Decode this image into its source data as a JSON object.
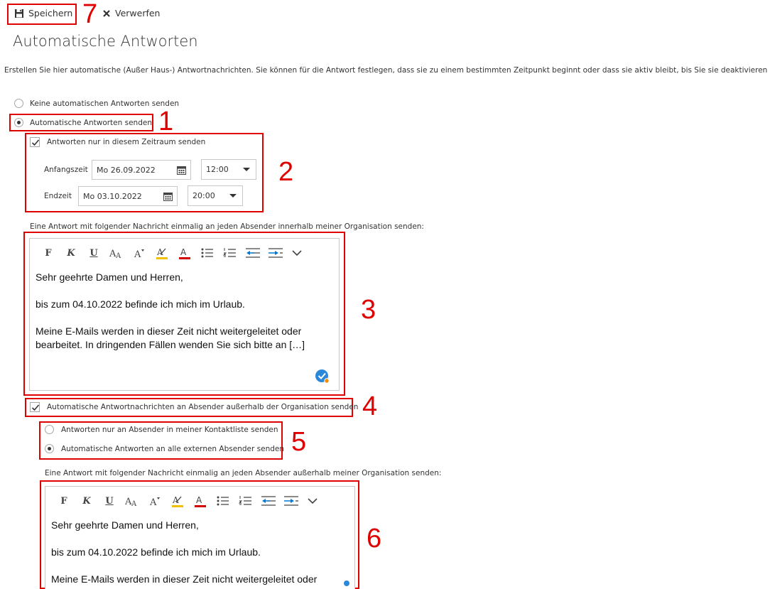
{
  "toolbar": {
    "save_label": "Speichern",
    "discard_label": "Verwerfen"
  },
  "page": {
    "title": "Automatische Antworten",
    "description": "Erstellen Sie hier automatische (Außer Haus-) Antwortnachrichten. Sie können für die Antwort festlegen, dass sie zu einem bestimmten Zeitpunkt beginnt oder dass sie aktiv bleibt, bis Sie sie deaktivieren"
  },
  "options": {
    "no_reply": "Keine automatischen Antworten senden",
    "send_reply": "Automatische Antworten senden",
    "time_range": "Antworten nur in diesem Zeitraum senden"
  },
  "schedule": {
    "start_label": "Anfangszeit",
    "start_date": "Mo 26.09.2022",
    "start_time": "12:00",
    "end_label": "Endzeit",
    "end_date": "Mo 03.10.2022",
    "end_time": "20:00"
  },
  "internal": {
    "label": "Eine Antwort mit folgender Nachricht einmalig an jeden Absender innerhalb meiner Organisation senden:",
    "lines": [
      "Sehr geehrte Damen und Herren,",
      "bis zum 04.10.2022 befinde ich mich im Urlaub.",
      "Meine E-Mails werden in dieser Zeit nicht weitergeleitet oder",
      "bearbeitet. In dringenden Fällen wenden Sie sich bitte an […]"
    ]
  },
  "external": {
    "toggle": "Automatische Antwortnachrichten an Absender außerhalb der Organisation senden",
    "contacts_only": "Antworten nur an Absender in meiner Kontaktliste senden",
    "all_external": "Automatische Antworten an alle externen Absender senden",
    "label": "Eine Antwort mit folgender Nachricht einmalig an jeden Absender außerhalb meiner Organisation senden:",
    "lines": [
      "Sehr geehrte Damen und Herren,",
      "bis zum 04.10.2022 befinde ich mich im Urlaub.",
      "Meine E-Mails werden in dieser Zeit nicht weitergeleitet oder"
    ]
  },
  "format_toolbar": {
    "bold": "F",
    "italic": "K",
    "underline": "U"
  },
  "annotations": [
    "1",
    "2",
    "3",
    "4",
    "5",
    "6",
    "7"
  ],
  "colors": {
    "annotation": "#e00000",
    "accent_blue": "#0078d4",
    "highlight": "#f0c000",
    "font_color": "#d00000"
  }
}
